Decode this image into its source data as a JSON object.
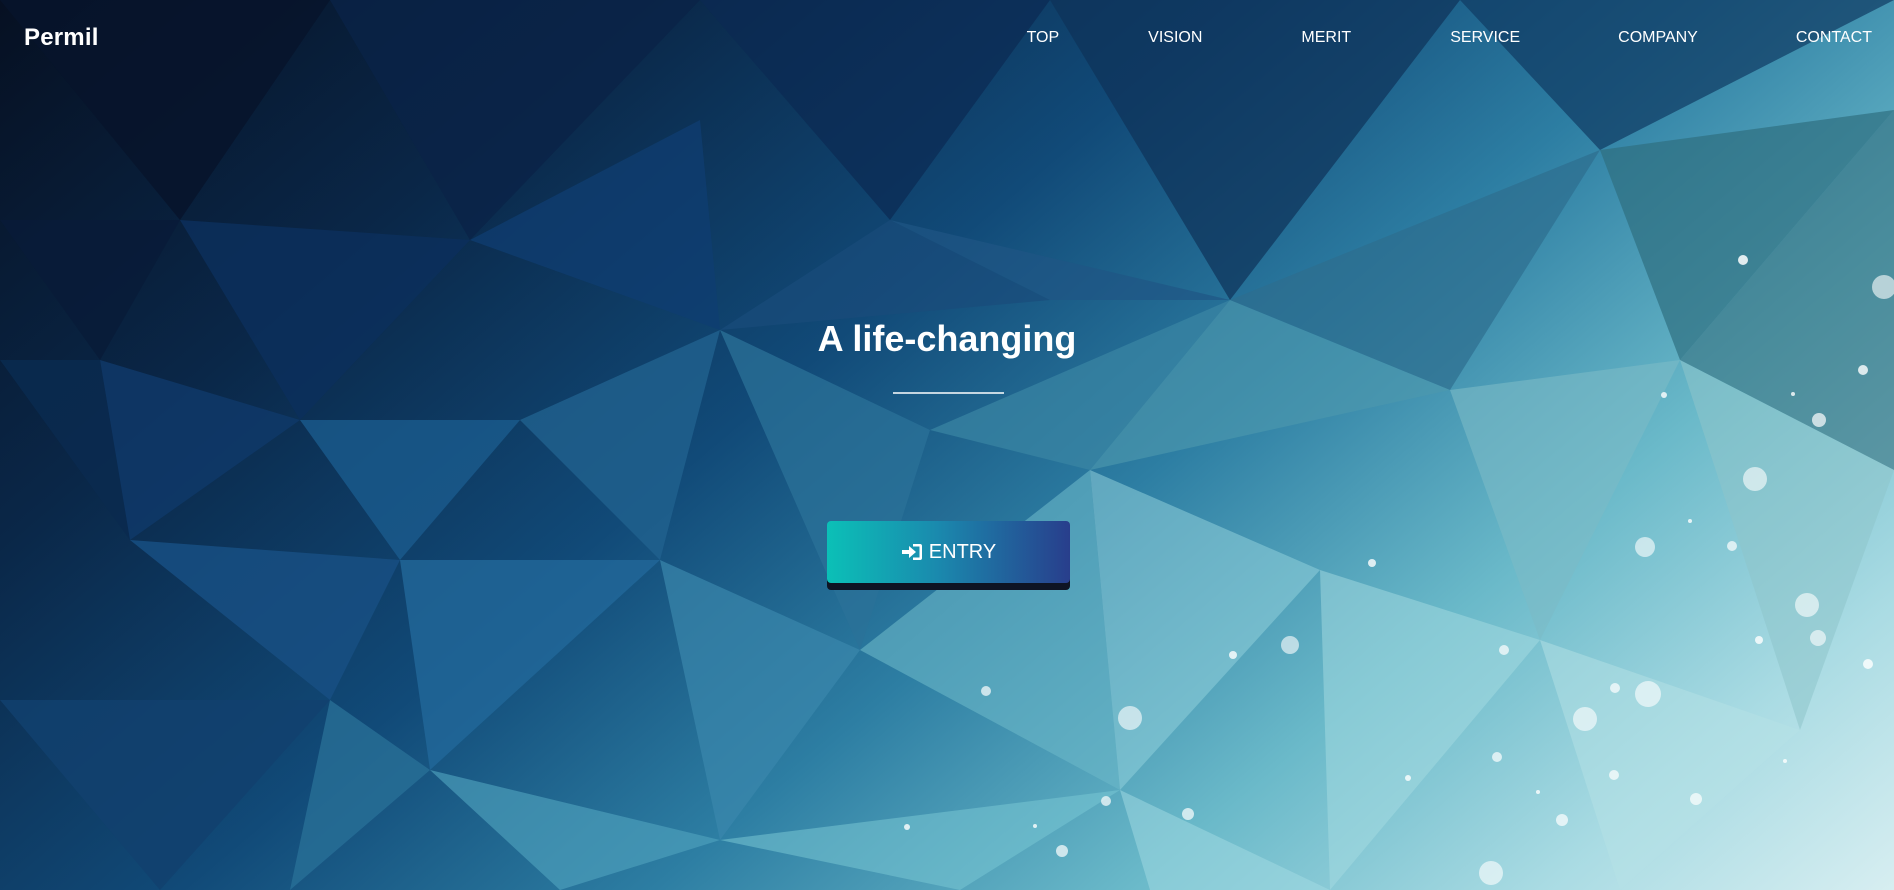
{
  "header": {
    "logo": "Permil",
    "nav": [
      {
        "label": "TOP"
      },
      {
        "label": "VISION"
      },
      {
        "label": "MERIT"
      },
      {
        "label": "SERVICE"
      },
      {
        "label": "COMPANY"
      },
      {
        "label": "CONTACT"
      }
    ]
  },
  "hero": {
    "title": "A life-changing",
    "entry_button": {
      "label": "ENTRY",
      "icon": "sign-in-icon",
      "gradient_start": "#0bc0b7",
      "gradient_end": "#283e8c"
    }
  },
  "colors": {
    "text": "#ffffff",
    "bg_dark": "#061022",
    "bg_light": "#d7eef1"
  }
}
